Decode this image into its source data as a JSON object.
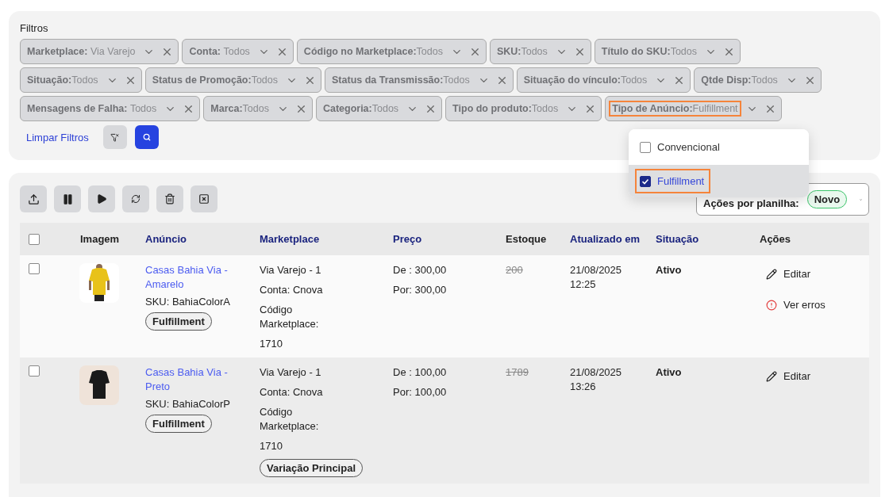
{
  "filters": {
    "title": "Filtros",
    "chip_rows": [
      [
        {
          "label": "Marketplace: ",
          "value": "Via Varejo",
          "highlighted": false
        },
        {
          "label": "Conta: ",
          "value": "Todos",
          "highlighted": false
        },
        {
          "label": "Código no Marketplace:",
          "value": "Todos",
          "highlighted": false
        },
        {
          "label": "SKU:",
          "value": "Todos",
          "highlighted": false
        },
        {
          "label": "Título do SKU:",
          "value": "Todos",
          "highlighted": false
        }
      ],
      [
        {
          "label": "Situação:",
          "value": "Todos",
          "highlighted": false
        },
        {
          "label": "Status de Promoção:",
          "value": "Todos",
          "highlighted": false
        },
        {
          "label": "Status da Transmissão:",
          "value": "Todos",
          "highlighted": false
        },
        {
          "label": "Situação do vínculo:",
          "value": "Todos",
          "highlighted": false
        },
        {
          "label": "Qtde Disp:",
          "value": "Todos",
          "highlighted": false
        }
      ],
      [
        {
          "label": "Mensagens de Falha: ",
          "value": "Todos",
          "highlighted": false
        },
        {
          "label": "Marca:",
          "value": "Todos",
          "highlighted": false
        },
        {
          "label": "Categoria:",
          "value": "Todos",
          "highlighted": false
        },
        {
          "label": "Tipo do produto:",
          "value": "Todos",
          "highlighted": false
        },
        {
          "label": "Tipo de Anúncio:",
          "value": "Fulfillment",
          "highlighted": true
        }
      ]
    ],
    "clear_link": "Limpar Filtros",
    "dropdown": {
      "options": [
        {
          "label": "Convencional",
          "checked": false,
          "selected": false,
          "highlighted": false
        },
        {
          "label": "Fulfillment",
          "checked": true,
          "selected": true,
          "highlighted": true
        }
      ]
    }
  },
  "toolbar": {
    "spreadsheet_actions": {
      "label": "Ações por planilha:",
      "badge": "Novo"
    }
  },
  "table": {
    "select_all_checked": false,
    "columns": [
      {
        "label": "Imagem",
        "sortable": false
      },
      {
        "label": "Anúncio",
        "sortable": true
      },
      {
        "label": "Marketplace",
        "sortable": true
      },
      {
        "label": "Preço",
        "sortable": true
      },
      {
        "label": "Estoque",
        "sortable": false
      },
      {
        "label": "Atualizado em",
        "sortable": true
      },
      {
        "label": "Situação",
        "sortable": true
      },
      {
        "label": "Ações",
        "sortable": false
      }
    ],
    "rows": [
      {
        "checked": false,
        "image": {
          "kind": "picture"
        },
        "title": "Casas Bahia Via - Amarelo",
        "sku": "SKU: BahiaColorA",
        "type_badge": "Fulfillment",
        "marketplace": "Via Varejo - 1",
        "account": "Conta: Cnova",
        "code_label": "Código Marketplace:",
        "code": "1710",
        "price_from": "De : 300,00",
        "price_to": "Por: 300,00",
        "stock": "200",
        "updated_date": "21/08/2025",
        "updated_time": "12:25",
        "status": "Ativo",
        "actions": [
          {
            "kind": "edit",
            "label": "Editar"
          },
          {
            "kind": "errors",
            "label": "Ver erros"
          }
        ]
      },
      {
        "checked": false,
        "image": {
          "kind": "picture"
        },
        "title": "Casas Bahia Via - Preto",
        "sku": "SKU: BahiaColorP",
        "type_badge": "Fulfillment",
        "marketplace": "Via Varejo - 1",
        "account": "Conta: Cnova",
        "code_label": "Código Marketplace:",
        "code": "1710",
        "variation_badge": "Variação Principal",
        "price_from": "De : 100,00",
        "price_to": "Por: 100,00",
        "stock": "1789",
        "updated_date": "21/08/2025",
        "updated_time": "13:26",
        "status": "Ativo",
        "actions": [
          {
            "kind": "edit",
            "label": "Editar"
          }
        ]
      }
    ]
  }
}
